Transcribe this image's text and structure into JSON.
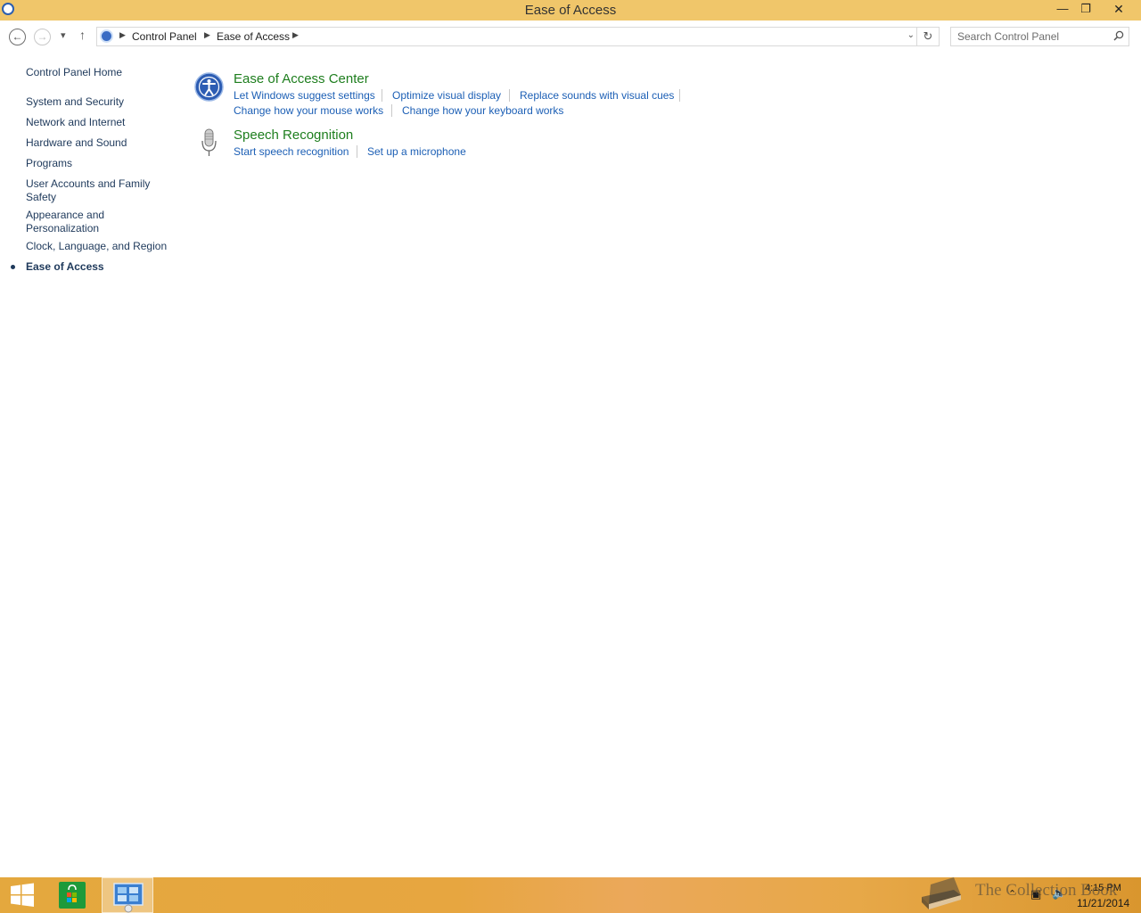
{
  "window": {
    "title": "Ease of Access",
    "minimize_glyph": "—",
    "restore_glyph": "❐",
    "close_glyph": "✕"
  },
  "address": {
    "crumbs": [
      "Control Panel",
      "Ease of Access"
    ],
    "search_placeholder": "Search Control Panel"
  },
  "sidebar": {
    "home": "Control Panel Home",
    "items": [
      {
        "label": "System and Security"
      },
      {
        "label": "Network and Internet"
      },
      {
        "label": "Hardware and Sound"
      },
      {
        "label": "Programs"
      },
      {
        "label": "User Accounts and Family Safety"
      },
      {
        "label": "Appearance and Personalization"
      },
      {
        "label": "Clock, Language, and Region"
      },
      {
        "label": "Ease of Access",
        "current": true
      }
    ]
  },
  "categories": [
    {
      "title": "Ease of Access Center",
      "icon": "ease-of-access-icon",
      "tasks": [
        "Let Windows suggest settings",
        "Optimize visual display",
        "Replace sounds with visual cues",
        "Change how your mouse works",
        "Change how your keyboard works"
      ]
    },
    {
      "title": "Speech Recognition",
      "icon": "microphone-icon",
      "tasks": [
        "Start speech recognition",
        "Set up a microphone"
      ]
    }
  ],
  "taskbar": {
    "time": "4:15 PM",
    "date": "11/21/2014",
    "watermark": "The Collection Book"
  },
  "colors": {
    "titlebar": "#f0c66a",
    "link": "#1c5fb5",
    "category_title": "#1e7e1e",
    "nav_link": "#1e395b"
  }
}
